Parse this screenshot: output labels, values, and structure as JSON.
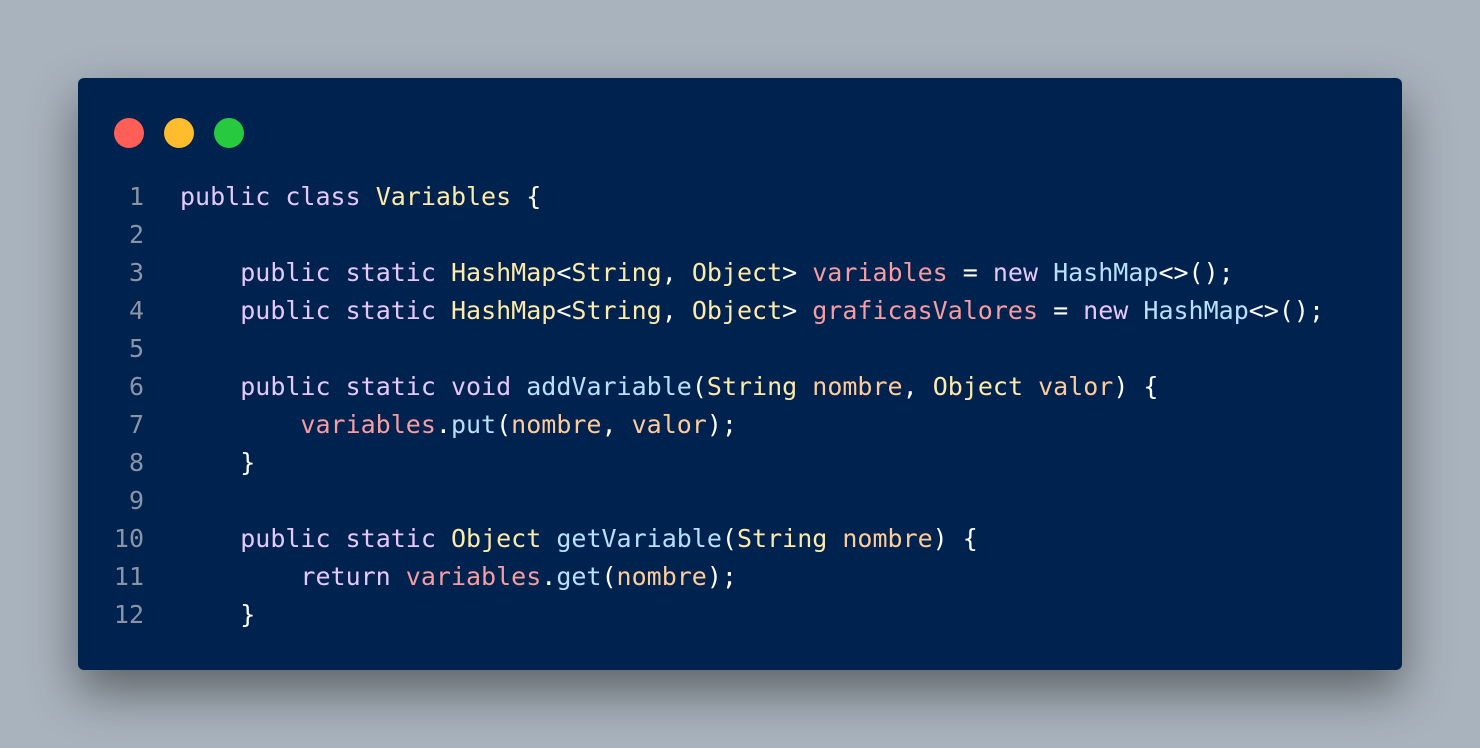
{
  "window": {
    "controls": {
      "close_color": "#ff5f56",
      "minimize_color": "#ffbd2e",
      "maximize_color": "#27c93f"
    }
  },
  "colors": {
    "background": "#a9b3bd",
    "editor": "#00224f",
    "keyword": "#e6c8ff",
    "type": "#ffeba8",
    "function": "#b8e0ff",
    "field": "#f79ca1",
    "parameter": "#ffcc99",
    "line_number": "#8a94a6"
  },
  "code": {
    "language": "java",
    "lines": [
      {
        "n": "1",
        "tokens": [
          {
            "t": "public",
            "c": "kw"
          },
          {
            "t": " ",
            "c": "pu"
          },
          {
            "t": "class",
            "c": "kw"
          },
          {
            "t": " ",
            "c": "pu"
          },
          {
            "t": "Variables",
            "c": "ty"
          },
          {
            "t": " {",
            "c": "pu"
          }
        ]
      },
      {
        "n": "2",
        "tokens": []
      },
      {
        "n": "3",
        "tokens": [
          {
            "t": "    ",
            "c": "pu"
          },
          {
            "t": "public",
            "c": "kw"
          },
          {
            "t": " ",
            "c": "pu"
          },
          {
            "t": "static",
            "c": "kw"
          },
          {
            "t": " ",
            "c": "pu"
          },
          {
            "t": "HashMap",
            "c": "ty"
          },
          {
            "t": "<",
            "c": "pu"
          },
          {
            "t": "String",
            "c": "ty"
          },
          {
            "t": ", ",
            "c": "pu"
          },
          {
            "t": "Object",
            "c": "ty"
          },
          {
            "t": "> ",
            "c": "pu"
          },
          {
            "t": "variables",
            "c": "fld"
          },
          {
            "t": " = ",
            "c": "pu"
          },
          {
            "t": "new",
            "c": "kw"
          },
          {
            "t": " ",
            "c": "pu"
          },
          {
            "t": "HashMap",
            "c": "fn"
          },
          {
            "t": "<>();",
            "c": "pu"
          }
        ]
      },
      {
        "n": "4",
        "tokens": [
          {
            "t": "    ",
            "c": "pu"
          },
          {
            "t": "public",
            "c": "kw"
          },
          {
            "t": " ",
            "c": "pu"
          },
          {
            "t": "static",
            "c": "kw"
          },
          {
            "t": " ",
            "c": "pu"
          },
          {
            "t": "HashMap",
            "c": "ty"
          },
          {
            "t": "<",
            "c": "pu"
          },
          {
            "t": "String",
            "c": "ty"
          },
          {
            "t": ", ",
            "c": "pu"
          },
          {
            "t": "Object",
            "c": "ty"
          },
          {
            "t": "> ",
            "c": "pu"
          },
          {
            "t": "graficasValores",
            "c": "fld"
          },
          {
            "t": " = ",
            "c": "pu"
          },
          {
            "t": "new",
            "c": "kw"
          },
          {
            "t": " ",
            "c": "pu"
          },
          {
            "t": "HashMap",
            "c": "fn"
          },
          {
            "t": "<>();",
            "c": "pu"
          }
        ]
      },
      {
        "n": "5",
        "tokens": []
      },
      {
        "n": "6",
        "tokens": [
          {
            "t": "    ",
            "c": "pu"
          },
          {
            "t": "public",
            "c": "kw"
          },
          {
            "t": " ",
            "c": "pu"
          },
          {
            "t": "static",
            "c": "kw"
          },
          {
            "t": " ",
            "c": "pu"
          },
          {
            "t": "void",
            "c": "kw"
          },
          {
            "t": " ",
            "c": "pu"
          },
          {
            "t": "addVariable",
            "c": "fn"
          },
          {
            "t": "(",
            "c": "pu"
          },
          {
            "t": "String",
            "c": "ty"
          },
          {
            "t": " ",
            "c": "pu"
          },
          {
            "t": "nombre",
            "c": "prm"
          },
          {
            "t": ", ",
            "c": "pu"
          },
          {
            "t": "Object",
            "c": "ty"
          },
          {
            "t": " ",
            "c": "pu"
          },
          {
            "t": "valor",
            "c": "prm"
          },
          {
            "t": ") {",
            "c": "pu"
          }
        ]
      },
      {
        "n": "7",
        "tokens": [
          {
            "t": "        ",
            "c": "pu"
          },
          {
            "t": "variables",
            "c": "fld"
          },
          {
            "t": ".",
            "c": "pu"
          },
          {
            "t": "put",
            "c": "fn"
          },
          {
            "t": "(",
            "c": "pu"
          },
          {
            "t": "nombre",
            "c": "prm"
          },
          {
            "t": ", ",
            "c": "pu"
          },
          {
            "t": "valor",
            "c": "prm"
          },
          {
            "t": ");",
            "c": "pu"
          }
        ]
      },
      {
        "n": "8",
        "tokens": [
          {
            "t": "    }",
            "c": "pu"
          }
        ]
      },
      {
        "n": "9",
        "tokens": []
      },
      {
        "n": "10",
        "tokens": [
          {
            "t": "    ",
            "c": "pu"
          },
          {
            "t": "public",
            "c": "kw"
          },
          {
            "t": " ",
            "c": "pu"
          },
          {
            "t": "static",
            "c": "kw"
          },
          {
            "t": " ",
            "c": "pu"
          },
          {
            "t": "Object",
            "c": "ty"
          },
          {
            "t": " ",
            "c": "pu"
          },
          {
            "t": "getVariable",
            "c": "fn"
          },
          {
            "t": "(",
            "c": "pu"
          },
          {
            "t": "String",
            "c": "ty"
          },
          {
            "t": " ",
            "c": "pu"
          },
          {
            "t": "nombre",
            "c": "prm"
          },
          {
            "t": ") {",
            "c": "pu"
          }
        ]
      },
      {
        "n": "11",
        "tokens": [
          {
            "t": "        ",
            "c": "pu"
          },
          {
            "t": "return",
            "c": "kw"
          },
          {
            "t": " ",
            "c": "pu"
          },
          {
            "t": "variables",
            "c": "fld"
          },
          {
            "t": ".",
            "c": "pu"
          },
          {
            "t": "get",
            "c": "fn"
          },
          {
            "t": "(",
            "c": "pu"
          },
          {
            "t": "nombre",
            "c": "prm"
          },
          {
            "t": ");",
            "c": "pu"
          }
        ]
      },
      {
        "n": "12",
        "tokens": [
          {
            "t": "    }",
            "c": "pu"
          }
        ]
      }
    ]
  }
}
